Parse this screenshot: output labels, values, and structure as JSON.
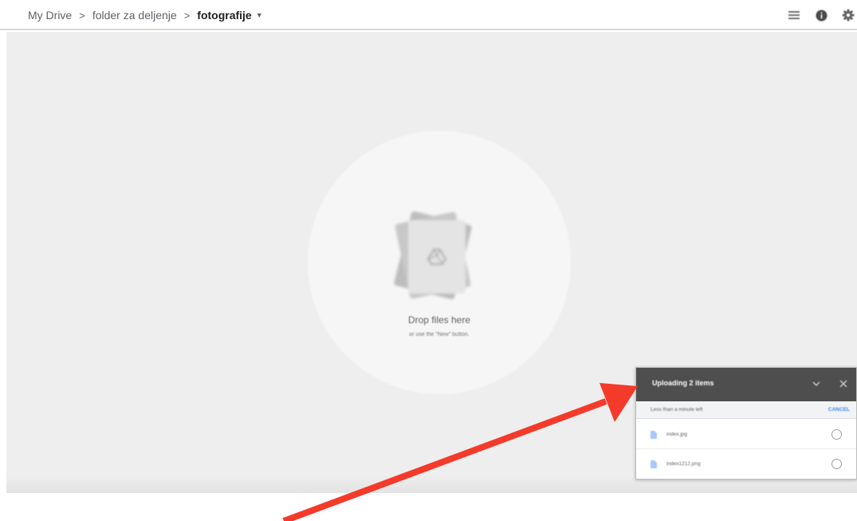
{
  "breadcrumb": {
    "items": [
      "My Drive",
      "folder za deljenje"
    ],
    "current": "fotografije",
    "separator_icon": "chevron-right-icon",
    "current_dropdown_icon": "caret-down-icon"
  },
  "toolbar": {
    "icons": [
      "list-view-icon",
      "info-icon",
      "settings-icon"
    ]
  },
  "dropzone": {
    "title": "Drop files here",
    "subtitle": "or use the \"New\" button."
  },
  "upload_panel": {
    "title": "Uploading 2 items",
    "status": "Less than a minute left",
    "cancel_label": "CANCEL",
    "files": [
      {
        "name": "index.jpg"
      },
      {
        "name": "index1212.png"
      }
    ],
    "header_color": "#4e4e4e",
    "accent_color": "#4285f4"
  },
  "annotation": {
    "arrow_color": "#f43a2a"
  }
}
